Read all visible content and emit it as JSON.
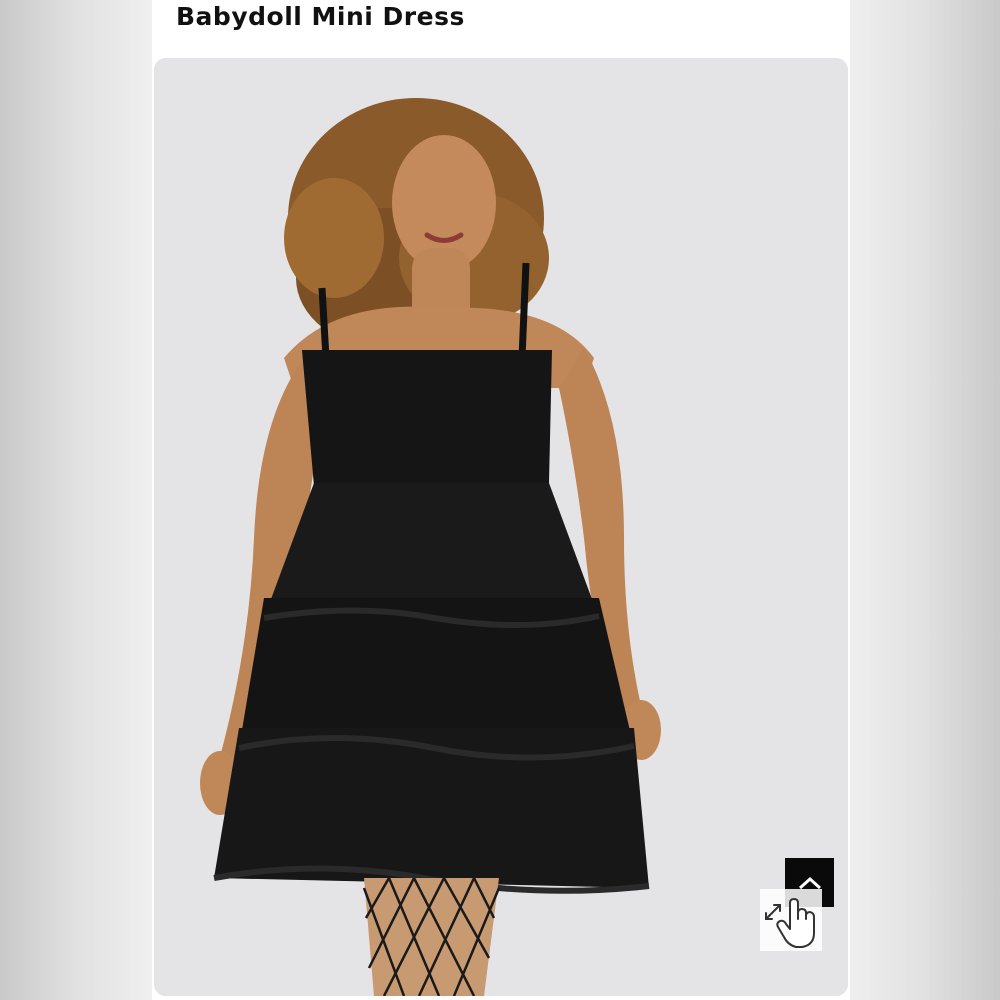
{
  "product": {
    "title": "Babydoll Mini Dress"
  },
  "image": {
    "subject": "product-photo",
    "background_color": "#e4e4e6",
    "dress_color": "#141414"
  },
  "controls": {
    "scroll_top_icon": "chevron-up-icon",
    "zoom_icon": "hand-pointer-zoom-icon"
  },
  "colors": {
    "page_bg": "#ffffff",
    "title_color": "#111111",
    "scroll_button_bg": "#0a0a0a"
  }
}
